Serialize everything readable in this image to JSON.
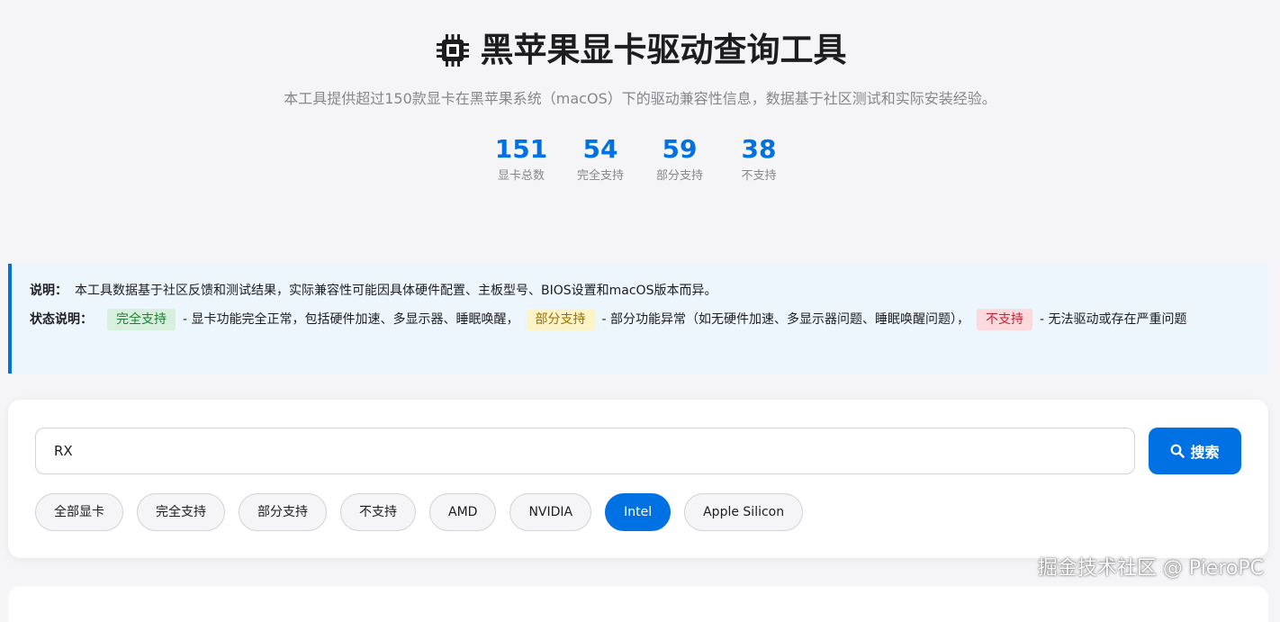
{
  "header": {
    "icon": "chip-icon",
    "title": "黑苹果显卡驱动查询工具",
    "subtitle": "本工具提供超过150款显卡在黑苹果系统（macOS）下的驱动兼容性信息，数据基于社区测试和实际安装经验。"
  },
  "stats": [
    {
      "value": "151",
      "label": "显卡总数"
    },
    {
      "value": "54",
      "label": "完全支持"
    },
    {
      "value": "59",
      "label": "部分支持"
    },
    {
      "value": "38",
      "label": "不支持"
    }
  ],
  "notice": {
    "note_label": "说明：",
    "note_text": "本工具数据基于社区反馈和测试结果，实际兼容性可能因具体硬件配置、主板型号、BIOS设置和macOS版本而异。",
    "status_label": "状态说明：",
    "full_tag": "完全支持",
    "full_text": "- 显卡功能完全正常，包括硬件加速、多显示器、睡眠唤醒，",
    "partial_tag": "部分支持",
    "partial_text": "- 部分功能异常（如无硬件加速、多显示器问题、睡眠唤醒问题），",
    "none_tag": "不支持",
    "none_text": "- 无法驱动或存在严重问题"
  },
  "search": {
    "value": "RX",
    "button_icon": "search-icon",
    "button_label": "搜索"
  },
  "filters": [
    {
      "label": "全部显卡",
      "active": false
    },
    {
      "label": "完全支持",
      "active": false
    },
    {
      "label": "部分支持",
      "active": false
    },
    {
      "label": "不支持",
      "active": false
    },
    {
      "label": "AMD",
      "active": false
    },
    {
      "label": "NVIDIA",
      "active": false
    },
    {
      "label": "Intel",
      "active": true
    },
    {
      "label": "Apple Silicon",
      "active": false
    }
  ],
  "watermark": "掘金技术社区 @ PieroPC",
  "colors": {
    "accent": "#0071e3",
    "full": "#d7f0dd",
    "partial": "#fdf3c9",
    "none": "#fbd9dc"
  }
}
